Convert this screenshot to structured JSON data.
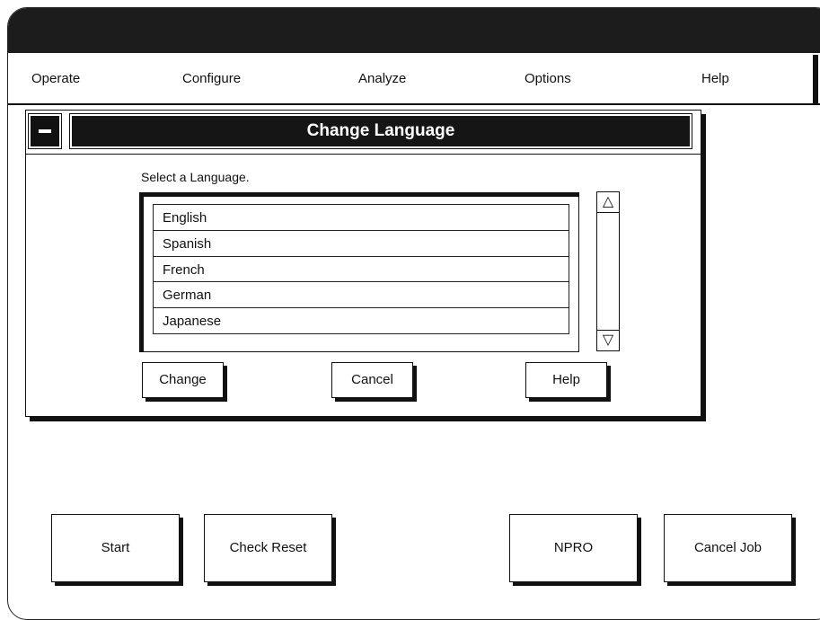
{
  "menu": {
    "items": [
      "Operate",
      "Configure",
      "Analyze",
      "Options",
      "Help"
    ]
  },
  "dialog": {
    "title": "Change Language",
    "prompt": "Select a Language.",
    "languages": [
      "English",
      "Spanish",
      "French",
      "German",
      "Japanese"
    ],
    "buttons": {
      "change": "Change",
      "cancel": "Cancel",
      "help": "Help"
    },
    "scroll_up_glyph": "△",
    "scroll_down_glyph": "▽"
  },
  "bottom_buttons": {
    "start": "Start",
    "check_reset": "Check Reset",
    "npro": "NPRO",
    "cancel_job": "Cancel Job"
  }
}
